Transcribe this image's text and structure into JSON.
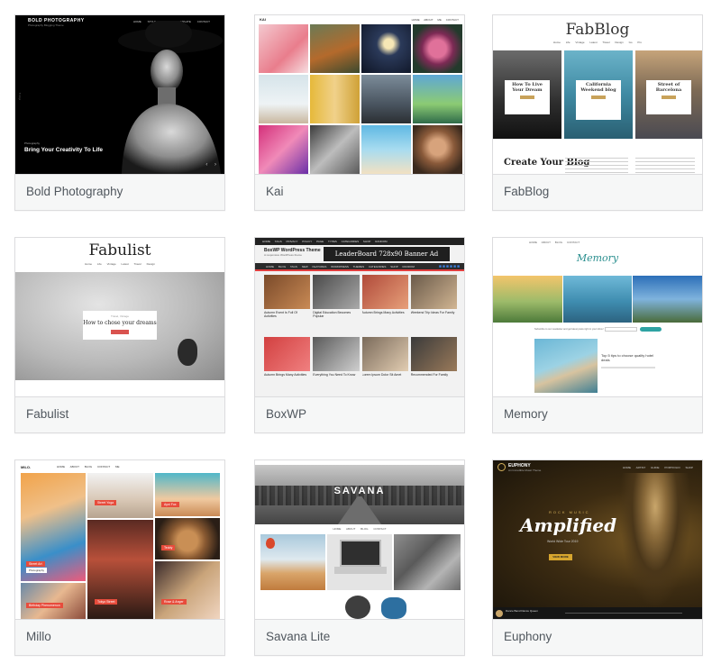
{
  "themes": [
    {
      "name": "Bold Photography",
      "preview": {
        "logo": "BOLD PHOTOGRAPHY",
        "tagline": "Photography Blogging Theme",
        "nav": "HOME STYLE GUIDE TEMPLATE CONTACT",
        "kicker": "Photography",
        "headline": "Bring Your Creativity To Life",
        "social": "f  t  in  p",
        "arrows": "‹ ›"
      }
    },
    {
      "name": "Kai",
      "preview": {
        "logo": "KAI",
        "nav": "HOME ABOUT ME CONTACT"
      }
    },
    {
      "name": "FabBlog",
      "preview": {
        "logo": "FabBlog",
        "nav": "Home Life Vintage Latest Travel Design Go Pro",
        "card1": "How To Live Your Dream",
        "card2": "California Weekend blog",
        "card3": "Street of Barcelona",
        "heading": "Create Your Blog"
      }
    },
    {
      "name": "Fabulist",
      "preview": {
        "logo": "Fabulist",
        "nav": "Home Life Vintage Latest Travel Design",
        "kicker": "Travel, Vintage",
        "headline": "How to chose your dreams"
      }
    },
    {
      "name": "BoxWP",
      "preview": {
        "logo": "BoxWP WordPress Theme",
        "tagline": "A responsive WordPress theme",
        "ad": "LeaderBoard 728x90 Banner Ad",
        "topnav": "HOME TAGS PRIVACY POLICY PAGE TYPES CATEGORIES SHOP RANDOM",
        "mainnav": "HOME BLOG TAGS NEW FEATURES WORDPRESS THEMES CATEGORIES SHOP RANDOM",
        "icons": "■■■■■■",
        "posts": [
          "Autumn Event Is Full Of Activities",
          "Digital Education Becomes Popular",
          "Autumn Brings Many Activities",
          "Weekend Trip Ideas For Family",
          "Autumn Brings Many Activities",
          "Everything You Need To Know",
          "Lorem Ipsum Dolor Sit Amet",
          "Recommended For Family"
        ]
      }
    },
    {
      "name": "Memory",
      "preview": {
        "logo": "Memory",
        "nav": "HOME ABOUT BLOG CONTACT",
        "newsletter": "Subscribe to our newsletter and get latest posts right in your inbox!",
        "post_title": "Top 5 tips to choose quality hotel deals"
      }
    },
    {
      "name": "Millo",
      "preview": {
        "logo": "MILO.",
        "nav": "HOME ABOUT BLOG CONTACT ME",
        "tags": [
          "Street Yoga",
          "Ayni Fox",
          "Street Art",
          "Teddy",
          "Birthday Phenomenon",
          "Tokyo Street",
          "Rose & Anger"
        ],
        "sub": "Photography"
      }
    },
    {
      "name": "Savana Lite",
      "preview": {
        "title": "SAVANA",
        "nav": "HOME ABOUT BLOG CONTACT"
      }
    },
    {
      "name": "Euphony",
      "preview": {
        "logo": "EUPHONY",
        "tagline": "An Incredible Music Theme",
        "nav": "HOME ARTIST GUIDE PORTFOLIO SHOP",
        "kicker": "ROCK MUSIC",
        "headline": "Amplified",
        "sub": "World Wide Tour 2019",
        "cta": "VIEW MORE",
        "track": "Dance Band Dance Queen"
      }
    }
  ]
}
